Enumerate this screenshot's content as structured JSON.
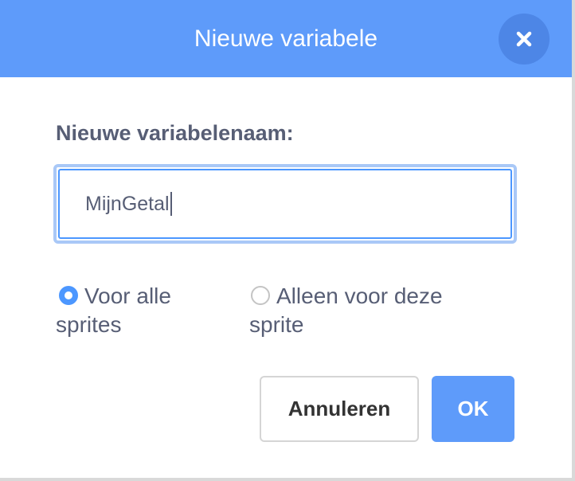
{
  "dialog": {
    "title": "Nieuwe variabele",
    "close_icon": "close-icon"
  },
  "name_field": {
    "label": "Nieuwe variabelenaam:",
    "value": "MijnGetal"
  },
  "scope": {
    "options": [
      {
        "label": "Voor alle sprites",
        "selected": true
      },
      {
        "label": "Alleen voor deze sprite",
        "selected": false
      }
    ]
  },
  "buttons": {
    "cancel_label": "Annuleren",
    "ok_label": "OK"
  },
  "colors": {
    "header": "#5e9bfa",
    "close_button": "#4d86e6",
    "accent": "#4c97ff",
    "text": "#575e75"
  }
}
